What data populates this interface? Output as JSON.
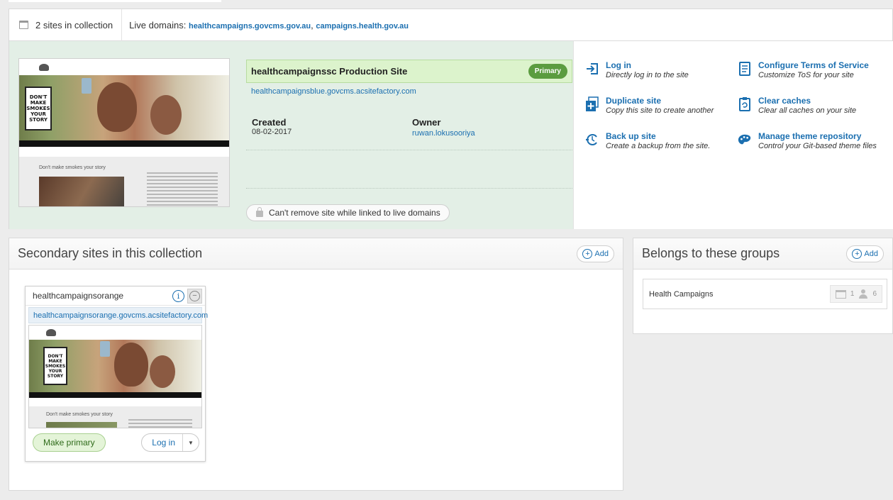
{
  "collection": {
    "count_label": "2 sites in collection",
    "live_label": "Live domains:",
    "live_domains": [
      "healthcampaigns.govcms.gov.au",
      "campaigns.health.gov.au"
    ],
    "live_sep": ","
  },
  "primary_site": {
    "title": "healthcampaignssc Production Site",
    "badge": "Primary",
    "url": "healthcampaignsblue.govcms.acsitefactory.com",
    "created_label": "Created",
    "created_value": "08-02-2017",
    "owner_label": "Owner",
    "owner_value": "ruwan.lokusooriya",
    "remove_label": "Can't remove site while linked to live domains"
  },
  "thumbnail": {
    "sign_lines": [
      "DON'T",
      "MAKE",
      "SMOKES",
      "YOUR",
      "STORY"
    ],
    "intro_text": "Don't make smokes your story"
  },
  "actions": [
    {
      "title": "Log in",
      "subtitle": "Directly log in to the site",
      "icon": "login-icon"
    },
    {
      "title": "Configure Terms of Service",
      "subtitle": "Customize ToS for your site",
      "icon": "document-icon"
    },
    {
      "title": "Duplicate site",
      "subtitle": "Copy this site to create another",
      "icon": "duplicate-icon"
    },
    {
      "title": "Clear caches",
      "subtitle": "Clear all caches on your site",
      "icon": "clipboard-refresh-icon"
    },
    {
      "title": "Back up site",
      "subtitle": "Create a backup from the site.",
      "icon": "backup-icon"
    },
    {
      "title": "Manage theme repository",
      "subtitle": "Control your Git-based theme files",
      "icon": "palette-icon"
    }
  ],
  "secondary": {
    "heading": "Secondary sites in this collection",
    "add_label": "Add",
    "site": {
      "name": "healthcampaignsorange",
      "url": "healthcampaignsorange.govcms.acsitefactory.com",
      "make_primary": "Make primary",
      "login": "Log in"
    }
  },
  "groups": {
    "heading": "Belongs to these groups",
    "add_label": "Add",
    "items": [
      {
        "name": "Health Campaigns",
        "sites": "1",
        "users": "6"
      }
    ]
  },
  "colors": {
    "link": "#1b6fb0",
    "primary_badge": "#5b9c3f",
    "primary_area": "#e3efe6",
    "title_bar": "#dcf3cc"
  }
}
